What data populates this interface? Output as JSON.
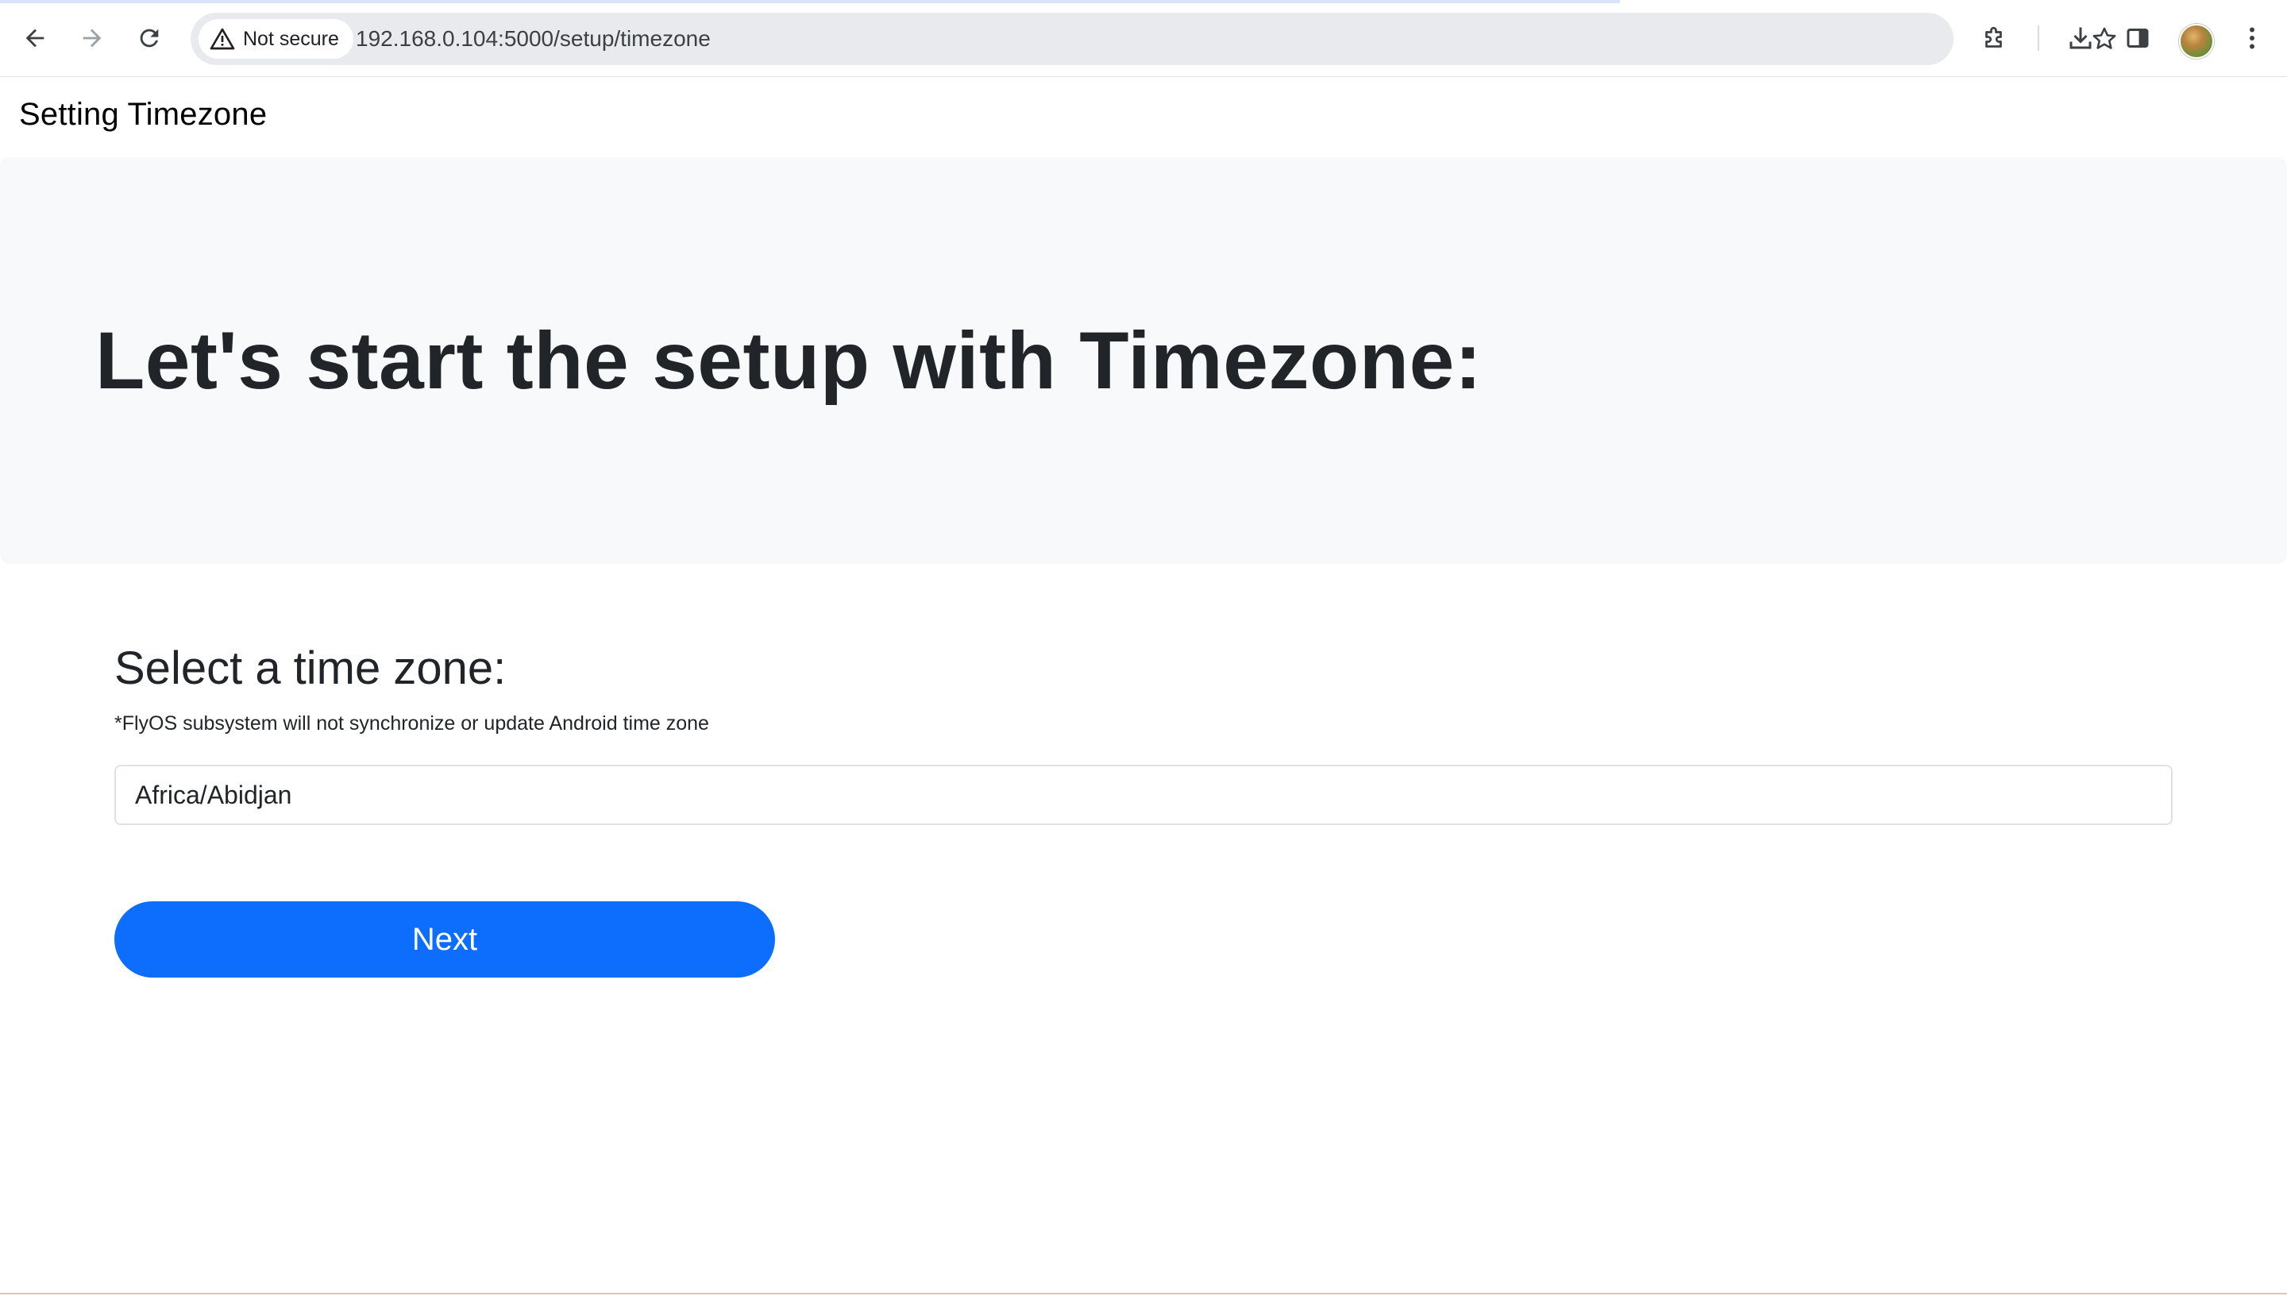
{
  "browser": {
    "security_label": "Not secure",
    "url": "192.168.0.104:5000/setup/timezone",
    "icons": {
      "back": "arrow-left-icon",
      "forward": "arrow-right-icon",
      "reload": "reload-icon",
      "warning": "warning-triangle-icon",
      "bookmark": "star-icon",
      "extensions": "puzzle-icon",
      "downloads": "download-icon",
      "side_panel": "side-panel-icon",
      "profile": "avatar",
      "menu": "kebab-menu-icon"
    }
  },
  "page": {
    "navbar_title": "Setting Timezone",
    "hero_heading": "Let's start the setup with Timezone:",
    "form_title": "Select a time zone:",
    "form_note": "*FlyOS subsystem will not synchronize or update Android time zone",
    "timezone_value": "Africa/Abidjan",
    "next_label": "Next"
  },
  "colors": {
    "primary": "#0d6efd",
    "hero_bg": "#f8f9fa",
    "text": "#212529"
  }
}
